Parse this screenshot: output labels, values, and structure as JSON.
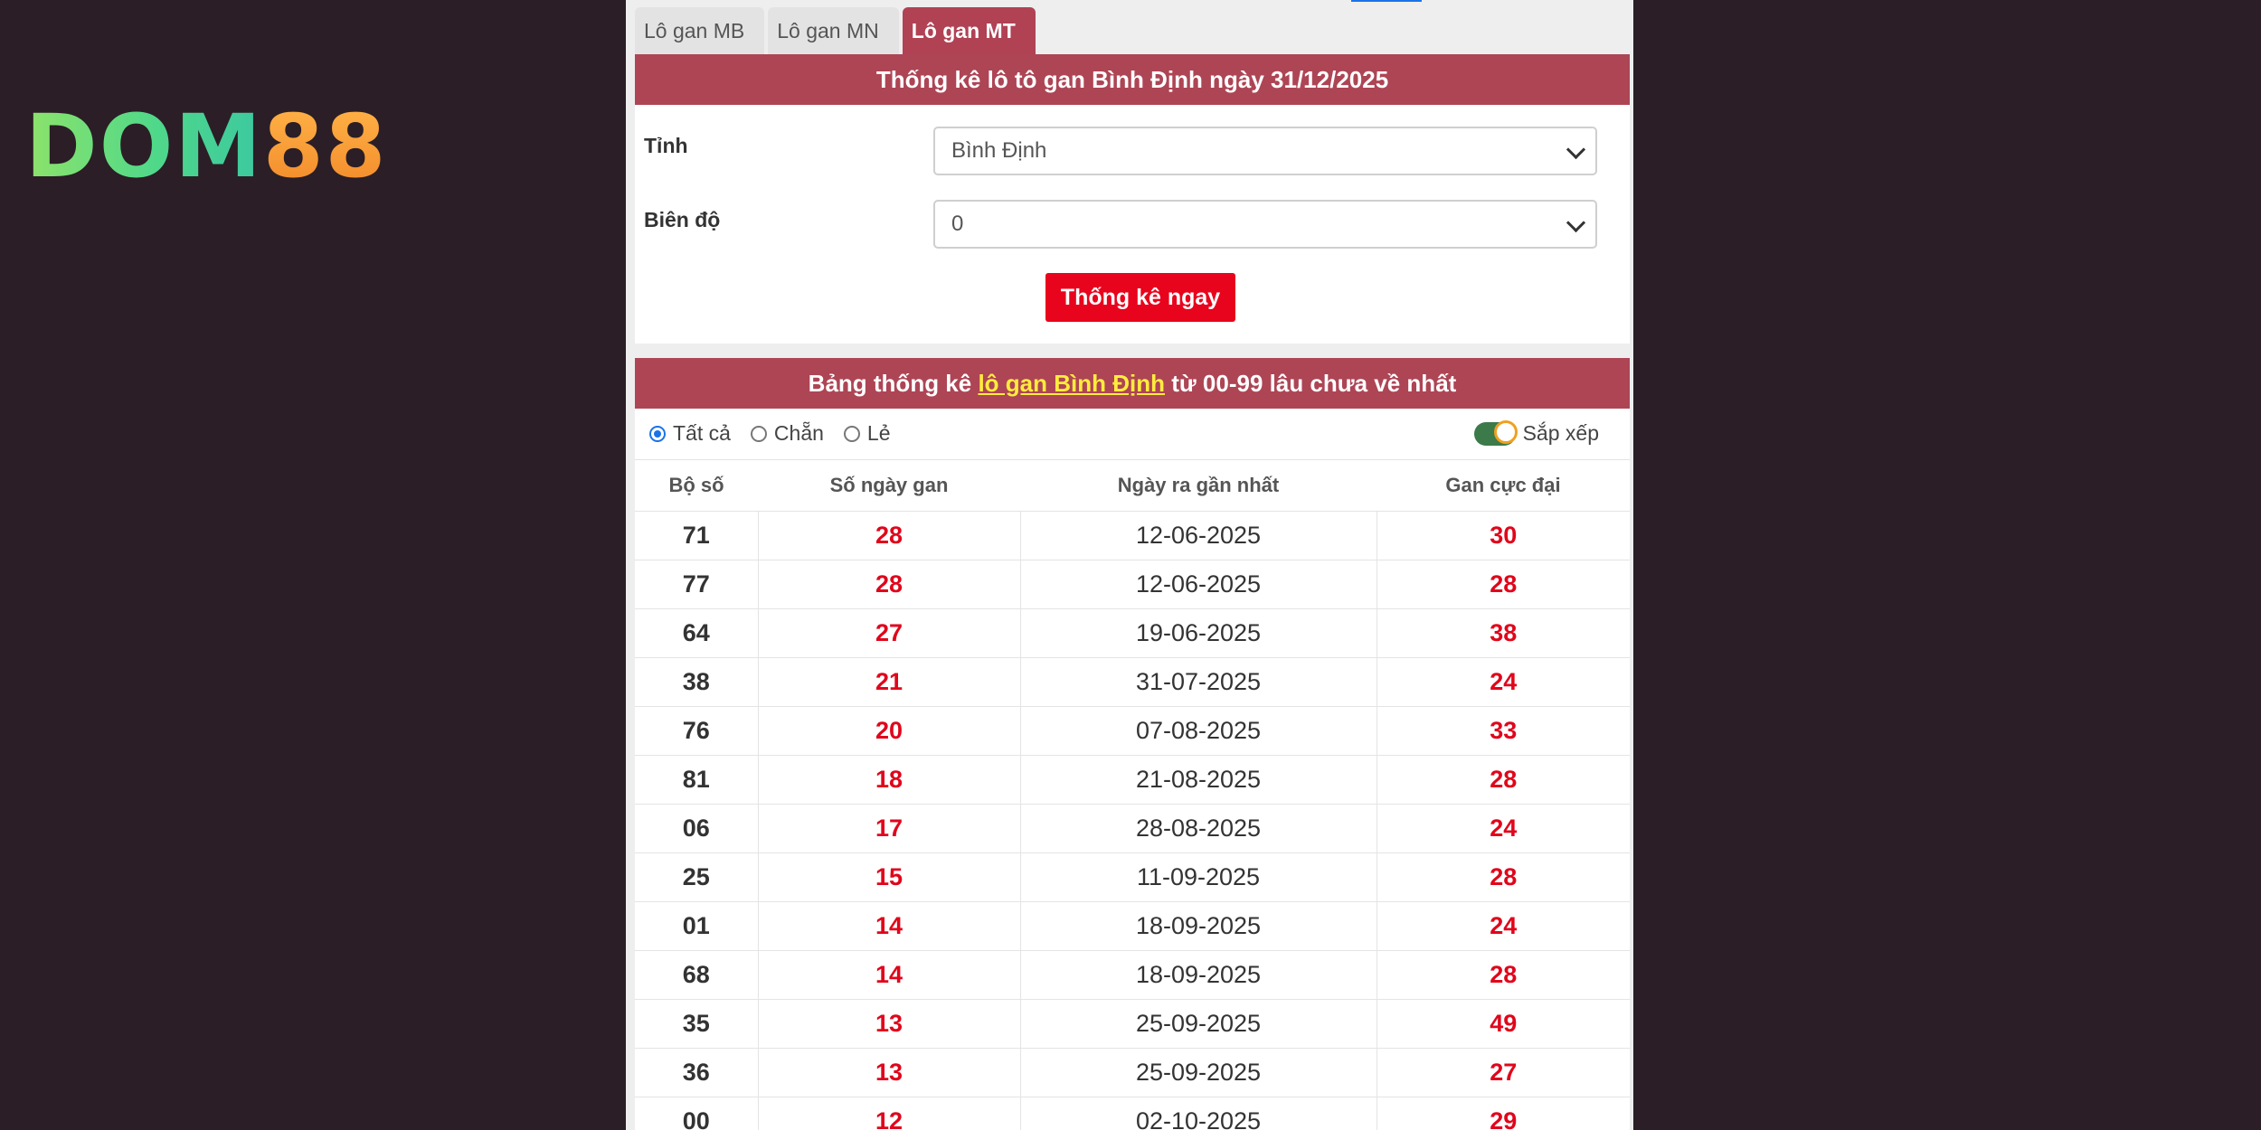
{
  "logo": {
    "part1": "DOM",
    "part2": "88"
  },
  "tabs": [
    {
      "label": "Lô gan MB",
      "active": false
    },
    {
      "label": "Lô gan MN",
      "active": false
    },
    {
      "label": "Lô gan MT",
      "active": true
    }
  ],
  "form": {
    "header": "Thống kê lô tô gan Bình Định ngày 31/12/2025",
    "province_label": "Tỉnh",
    "province_value": "Bình Định",
    "range_label": "Biên độ",
    "range_value": "0",
    "submit_label": "Thống kê ngay"
  },
  "table": {
    "title_prefix": "Bảng thống kê ",
    "title_link": "lô gan Bình Định",
    "title_suffix": " từ 00-99 lâu chưa về nhất",
    "filters": {
      "all": "Tất cả",
      "even": "Chẵn",
      "odd": "Lẻ",
      "sort": "Sắp xếp"
    },
    "columns": [
      "Bộ số",
      "Số ngày gan",
      "Ngày ra gần nhất",
      "Gan cực đại"
    ],
    "rows": [
      [
        "71",
        "28",
        "12-06-2025",
        "30"
      ],
      [
        "77",
        "28",
        "12-06-2025",
        "28"
      ],
      [
        "64",
        "27",
        "19-06-2025",
        "38"
      ],
      [
        "38",
        "21",
        "31-07-2025",
        "24"
      ],
      [
        "76",
        "20",
        "07-08-2025",
        "33"
      ],
      [
        "81",
        "18",
        "21-08-2025",
        "28"
      ],
      [
        "06",
        "17",
        "28-08-2025",
        "24"
      ],
      [
        "25",
        "15",
        "11-09-2025",
        "28"
      ],
      [
        "01",
        "14",
        "18-09-2025",
        "24"
      ],
      [
        "68",
        "14",
        "18-09-2025",
        "28"
      ],
      [
        "35",
        "13",
        "25-09-2025",
        "49"
      ],
      [
        "36",
        "13",
        "25-09-2025",
        "27"
      ],
      [
        "00",
        "12",
        "02-10-2025",
        "29"
      ]
    ]
  },
  "colors": {
    "background": "#2b1e26",
    "header": "#ad4555",
    "button": "#e8041c",
    "value_red": "#e0061b"
  }
}
